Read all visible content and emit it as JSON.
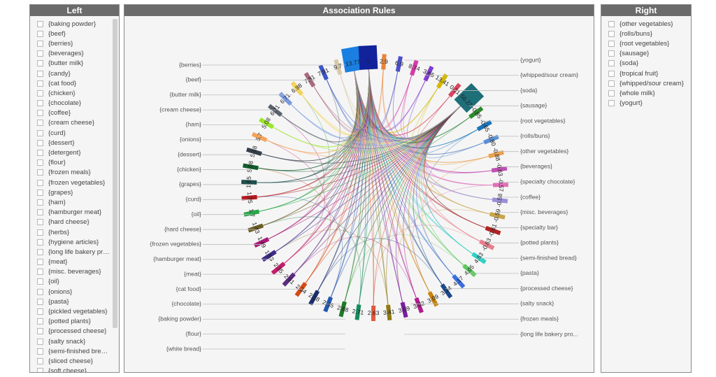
{
  "left_panel": {
    "title": "Left",
    "items": [
      "{baking powder}",
      "{beef}",
      "{berries}",
      "{beverages}",
      "{butter milk}",
      "{candy}",
      "{cat food}",
      "{chicken}",
      "{chocolate}",
      "{coffee}",
      "{cream cheese}",
      "{curd}",
      "{dessert}",
      "{detergent}",
      "{flour}",
      "{frozen meals}",
      "{frozen vegetables}",
      "{grapes}",
      "{ham}",
      "{hamburger meat}",
      "{hard cheese}",
      "{herbs}",
      "{hygiene articles}",
      "{long life bakery pro...",
      "{meat}",
      "{misc. beverages}",
      "{oil}",
      "{onions}",
      "{pasta}",
      "{pickled vegetables}",
      "{potted plants}",
      "{processed cheese}",
      "{salty snack}",
      "{semi-finished bread}",
      "{sliced cheese}",
      "{soft cheese}"
    ]
  },
  "right_panel": {
    "title": "Right",
    "items": [
      "{other vegetables}",
      "{rolls/buns}",
      "{root vegetables}",
      "{sausage}",
      "{soda}",
      "{tropical fruit}",
      "{whipped/sour cream}",
      "{whole milk}",
      "{yogurt}"
    ]
  },
  "chart_data": {
    "type": "chord",
    "title": "Association Rules",
    "left_labels": [
      "{berries}",
      "{beef}",
      "{butter milk}",
      "{cream cheese}",
      "{ham}",
      "{onions}",
      "{dessert}",
      "{chicken}",
      "{grapes}",
      "{curd}",
      "{oil}",
      "{hard cheese}",
      "{frozen vegetables}",
      "{hamburger meat}",
      "{meat}",
      "{cat food}",
      "{chocolate}",
      "{baking powder}",
      "{flour}",
      "{white bread}"
    ],
    "right_labels": [
      "{yogurt}",
      "{whipped/sour cream}",
      "{soda}",
      "{sausage}",
      "{root vegetables}",
      "{rolls/buns}",
      "{other vegetables}",
      "{beverages}",
      "{specialty chocolate}",
      "{coffee}",
      "{misc. beverages}",
      "{specialty bar}",
      "{potted plants}",
      "{semi-finished bread}",
      "{pasta}",
      "{processed cheese}",
      "{salty snack}",
      "{frozen meals}",
      "{long life bakery pro..."
    ],
    "arcs": [
      {
        "value": "13.77",
        "color": "#1a7fe0",
        "big": true
      },
      {
        "value": "0",
        "color": "#12229a",
        "big": true
      },
      {
        "value": "2.9",
        "color": "#e8833a"
      },
      {
        "value": "6.9",
        "color": "#4b4fc9"
      },
      {
        "value": "8.74",
        "color": "#d43ba8"
      },
      {
        "value": "3.65",
        "color": "#7e3ccf"
      },
      {
        "value": "13.41",
        "color": "#d4b800"
      },
      {
        "value": "0.21",
        "color": "#d8475e"
      },
      {
        "value": "56.22",
        "color": "#1d6f78",
        "big": true
      },
      {
        "value": "-0.85",
        "color": "#2c8a2c"
      },
      {
        "value": "-0.65",
        "color": "#1a73b8"
      },
      {
        "value": "-0.80",
        "color": "#5a8fd6"
      },
      {
        "value": "-0.88",
        "color": "#e8a24e"
      },
      {
        "value": "-0.63",
        "color": "#c04fb4"
      },
      {
        "value": "-0.57",
        "color": "#e070b8"
      },
      {
        "value": "-0.58",
        "color": "#9d8ed8"
      },
      {
        "value": "-0.59",
        "color": "#c9a54a"
      },
      {
        "value": "-0.61",
        "color": "#b22222"
      },
      {
        "value": "-0.63",
        "color": "#e67e8b"
      },
      {
        "value": "4.63",
        "color": "#2fd1c6"
      },
      {
        "value": "4.05",
        "color": "#5ec95e"
      },
      {
        "value": "4.17",
        "color": "#3b6fe0"
      },
      {
        "value": "3.14",
        "color": "#1b4a8a"
      },
      {
        "value": "3.09",
        "color": "#c8830a"
      },
      {
        "value": "3.02",
        "color": "#b01c8c"
      },
      {
        "value": "3.09",
        "color": "#7a1f9e"
      },
      {
        "value": "3.41",
        "color": "#8f7a12"
      },
      {
        "value": "2.63",
        "color": "#e05a3f"
      },
      {
        "value": "2.71",
        "color": "#138c5c"
      },
      {
        "value": "2.88",
        "color": "#1e7a26"
      },
      {
        "value": "2.45",
        "color": "#2457b0"
      },
      {
        "value": "2.18",
        "color": "#1a2e6b"
      },
      {
        "value": "2.34",
        "color": "#d64a16"
      },
      {
        "value": "2.91",
        "color": "#5c2c7e"
      },
      {
        "value": "2.35",
        "color": "#c41c6a"
      },
      {
        "value": "1.53",
        "color": "#3f2a8a"
      },
      {
        "value": "1.49",
        "color": "#a81c78"
      },
      {
        "value": "1.43",
        "color": "#6b5a24"
      },
      {
        "value": "1.7",
        "color": "#2aa84a"
      },
      {
        "value": "1.75",
        "color": "#b01c22"
      },
      {
        "value": "1.65",
        "color": "#1f4f4f"
      },
      {
        "value": "5.08",
        "color": "#0f5c2c"
      },
      {
        "value": "5.18",
        "color": "#353f4a"
      },
      {
        "value": "5.7",
        "color": "#f4a460"
      },
      {
        "value": "5.08",
        "color": "#9ae62a"
      },
      {
        "value": "6.71",
        "color": "#5a6270"
      },
      {
        "value": "6.71",
        "color": "#7a9ae0"
      },
      {
        "value": "6.98",
        "color": "#f5d35a"
      },
      {
        "value": "7.81",
        "color": "#a86a7e"
      },
      {
        "value": "7.91",
        "color": "#3a58c8"
      },
      {
        "value": "9.7",
        "color": "#d9c9a8"
      }
    ]
  }
}
